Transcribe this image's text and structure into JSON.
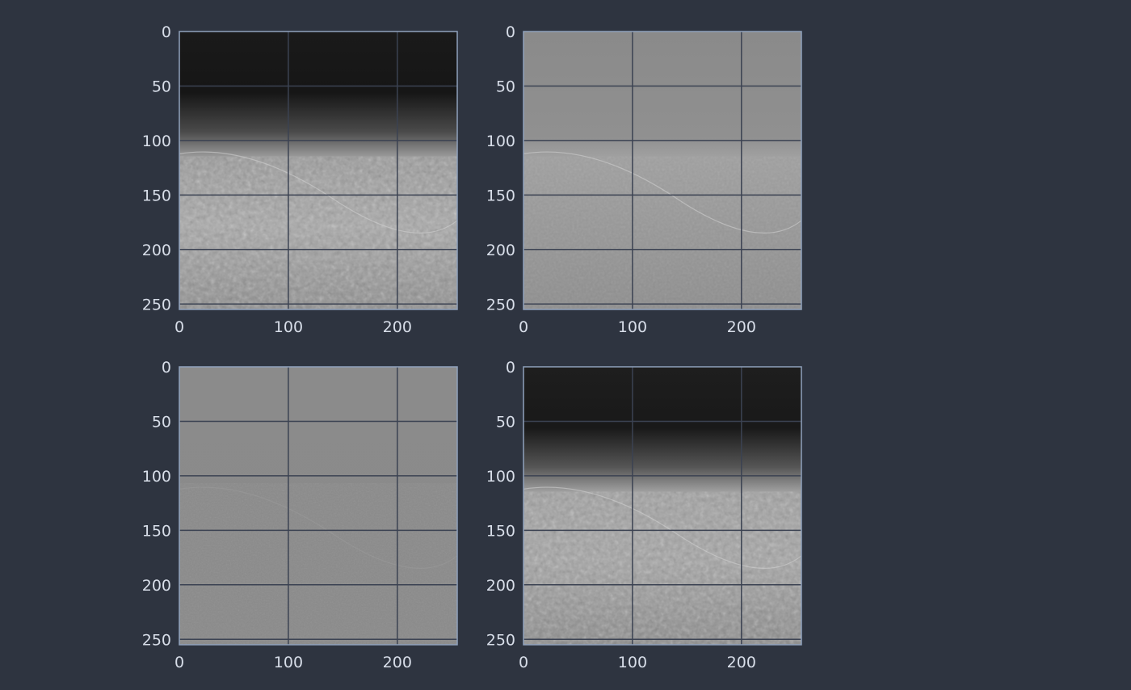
{
  "colors": {
    "background": "#2e3440",
    "grid": "#3b4252",
    "frame": "#8fa1bc",
    "tick_text": "#d8dee9"
  },
  "chart_data": [
    {
      "type": "heatmap",
      "image": "grayscale photo",
      "title": "",
      "xlabel": "",
      "ylabel": "",
      "xlim": [
        0,
        255
      ],
      "ylim": [
        255,
        0
      ],
      "xticks": [
        0,
        100,
        200
      ],
      "yticks": [
        0,
        50,
        100,
        150,
        200,
        250
      ],
      "xtick_labels": [
        "0",
        "100",
        "200"
      ],
      "ytick_labels": [
        "0",
        "50",
        "100",
        "150",
        "200",
        "250"
      ],
      "grid": true,
      "legend": "none"
    },
    {
      "type": "heatmap",
      "image": "grayscale high-pass detail (mid-gray background)",
      "title": "",
      "xlabel": "",
      "ylabel": "",
      "xlim": [
        0,
        255
      ],
      "ylim": [
        255,
        0
      ],
      "xticks": [
        0,
        100,
        200
      ],
      "yticks": [
        0,
        50,
        100,
        150,
        200,
        250
      ],
      "xtick_labels": [
        "0",
        "100",
        "200"
      ],
      "ytick_labels": [
        "0",
        "50",
        "100",
        "150",
        "200",
        "250"
      ],
      "grid": true,
      "legend": "none"
    },
    {
      "type": "heatmap",
      "image": "grayscale fine-detail residual (flat gray)",
      "title": "",
      "xlabel": "",
      "ylabel": "",
      "xlim": [
        0,
        255
      ],
      "ylim": [
        255,
        0
      ],
      "xticks": [
        0,
        100,
        200
      ],
      "yticks": [
        0,
        50,
        100,
        150,
        200,
        250
      ],
      "xtick_labels": [
        "0",
        "100",
        "200"
      ],
      "ytick_labels": [
        "0",
        "50",
        "100",
        "150",
        "200",
        "250"
      ],
      "grid": true,
      "legend": "none"
    },
    {
      "type": "heatmap",
      "image": "grayscale reconstructed photo",
      "title": "",
      "xlabel": "",
      "ylabel": "",
      "xlim": [
        0,
        255
      ],
      "ylim": [
        255,
        0
      ],
      "xticks": [
        0,
        100,
        200
      ],
      "yticks": [
        0,
        50,
        100,
        150,
        200,
        250
      ],
      "xtick_labels": [
        "0",
        "100",
        "200"
      ],
      "ytick_labels": [
        "0",
        "50",
        "100",
        "150",
        "200",
        "250"
      ],
      "grid": true,
      "legend": "none"
    }
  ]
}
